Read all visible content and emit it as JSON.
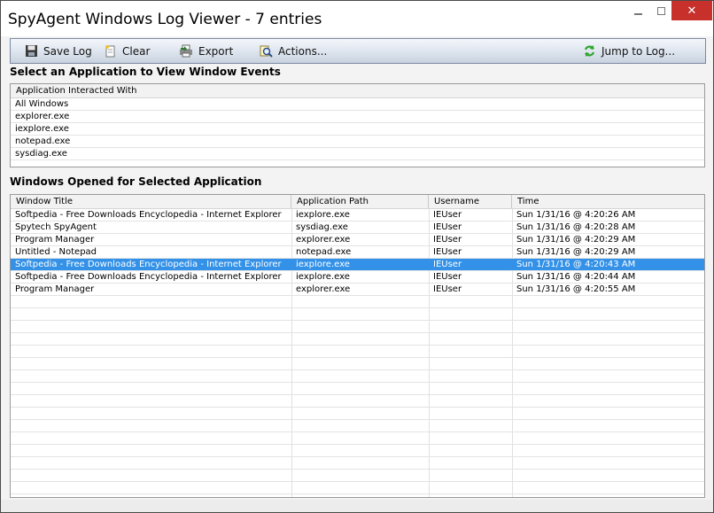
{
  "window": {
    "title": "SpyAgent Windows Log Viewer - 7 entries",
    "close_glyph": "✕"
  },
  "toolbar": {
    "save_label": "Save Log",
    "clear_label": "Clear",
    "export_label": "Export",
    "actions_label": "Actions...",
    "jump_label": "Jump to Log..."
  },
  "apps_section": {
    "label": "Select an Application to View Window Events",
    "column": "Application Interacted With",
    "items": [
      "All Windows",
      "explorer.exe",
      "iexplore.exe",
      "notepad.exe",
      "sysdiag.exe"
    ]
  },
  "windows_section": {
    "label": "Windows Opened for Selected Application",
    "columns": [
      "Window Title",
      "Application Path",
      "Username",
      "Time"
    ],
    "selected_index": 4,
    "rows": [
      [
        "Softpedia - Free Downloads Encyclopedia - Internet Explorer",
        "iexplore.exe",
        "IEUser",
        "Sun  1/31/16 @ 4:20:26 AM"
      ],
      [
        "Spytech SpyAgent",
        "sysdiag.exe",
        "IEUser",
        "Sun  1/31/16 @ 4:20:28 AM"
      ],
      [
        "Program Manager",
        "explorer.exe",
        "IEUser",
        "Sun  1/31/16 @ 4:20:29 AM"
      ],
      [
        "Untitled - Notepad",
        "notepad.exe",
        "IEUser",
        "Sun  1/31/16 @ 4:20:29 AM"
      ],
      [
        "Softpedia - Free Downloads Encyclopedia - Internet Explorer",
        "iexplore.exe",
        "IEUser",
        "Sun  1/31/16 @ 4:20:43 AM"
      ],
      [
        "Softpedia - Free Downloads Encyclopedia - Internet Explorer",
        "iexplore.exe",
        "IEUser",
        "Sun  1/31/16 @ 4:20:44 AM"
      ],
      [
        "Program Manager",
        "explorer.exe",
        "IEUser",
        "Sun  1/31/16 @ 4:20:55 AM"
      ]
    ]
  },
  "colors": {
    "selection": "#3391e8",
    "close_button": "#c7302b",
    "toolbar_border": "#7a8aa0"
  },
  "icons": {
    "save": "floppy-disk-icon",
    "clear": "clear-page-icon",
    "export": "export-printer-icon",
    "actions": "magnifier-icon",
    "jump": "green-refresh-arrows-icon"
  }
}
